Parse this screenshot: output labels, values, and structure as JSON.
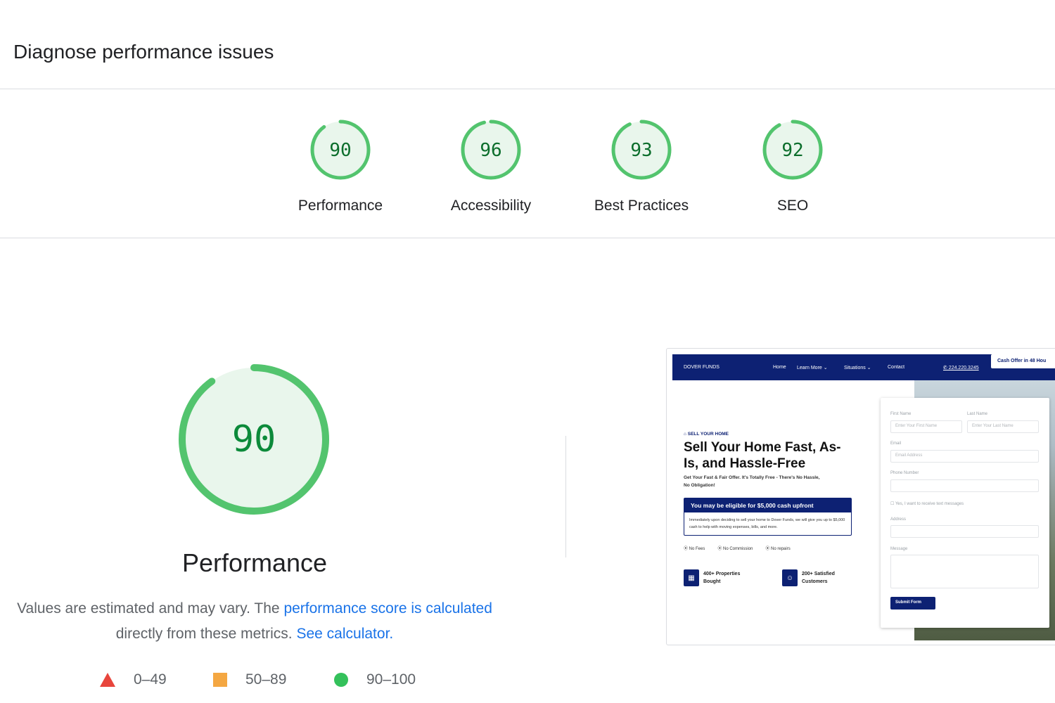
{
  "header": {
    "title": "Diagnose performance issues"
  },
  "categories": [
    {
      "score": "90",
      "label": "Performance",
      "value": 90
    },
    {
      "score": "96",
      "label": "Accessibility",
      "value": 96
    },
    {
      "score": "93",
      "label": "Best Practices",
      "value": 93
    },
    {
      "score": "92",
      "label": "SEO",
      "value": 92
    }
  ],
  "main": {
    "score": "90",
    "score_value": 90,
    "label": "Performance",
    "desc_prefix": "Values are estimated and may vary. The",
    "desc_link": "performance score is calculated",
    "desc_middle": "directly from these metrics.",
    "desc_link2": "See calculator."
  },
  "legend": [
    {
      "range": "0–49",
      "color": "#e8453c",
      "shape": "triangle"
    },
    {
      "range": "50–89",
      "color": "#f4a742",
      "shape": "square"
    },
    {
      "range": "90–100",
      "color": "#34c15b",
      "shape": "circle"
    }
  ],
  "colors": {
    "pass_ring": "#53c46e",
    "pass_fill": "#e9f6ec",
    "pass_text": "#0c6e2c",
    "link": "#1a73e8"
  },
  "thumbnail": {
    "nav": {
      "logo": "DOVER FUNDS",
      "home": "Home",
      "learn": "Learn More ⌄",
      "situations": "Situations ⌄",
      "contact": "Contact",
      "phone": "✆ 224.220.3245",
      "cta": "Cash Offer in 48 Hou"
    },
    "kicker": "SELL YOUR HOME",
    "title": "Sell Your Home Fast, As-Is, and Hassle-Free",
    "subtitle": "Get Your Fast & Fair Offer. It's Totally Free - There's No Hassle, No Obligation!",
    "box_title": "You may be eligible for $5,000 cash upfront",
    "box_body": "Immediately upon deciding to sell your home to Dover Funds, we will give you up to $5,000 cash to help with moving expenses, bills, and more.",
    "checks": [
      "⦿ No Fees",
      "⦿ No Commission",
      "⦿ No repairs"
    ],
    "stat1": "400+ Properties Bought",
    "stat2": "200+ Satisfied Customers",
    "form": {
      "first_label": "First Name",
      "first_placeholder": "Enter Your First Name",
      "last_label": "Last Name",
      "last_placeholder": "Enter Your Last Name",
      "email_label": "Email",
      "email_placeholder": "Email Address",
      "phone_label": "Phone Number",
      "sms": "☐ Yes, I want to receive text messages",
      "address_label": "Address",
      "message_label": "Message",
      "submit": "Submit Form"
    }
  }
}
